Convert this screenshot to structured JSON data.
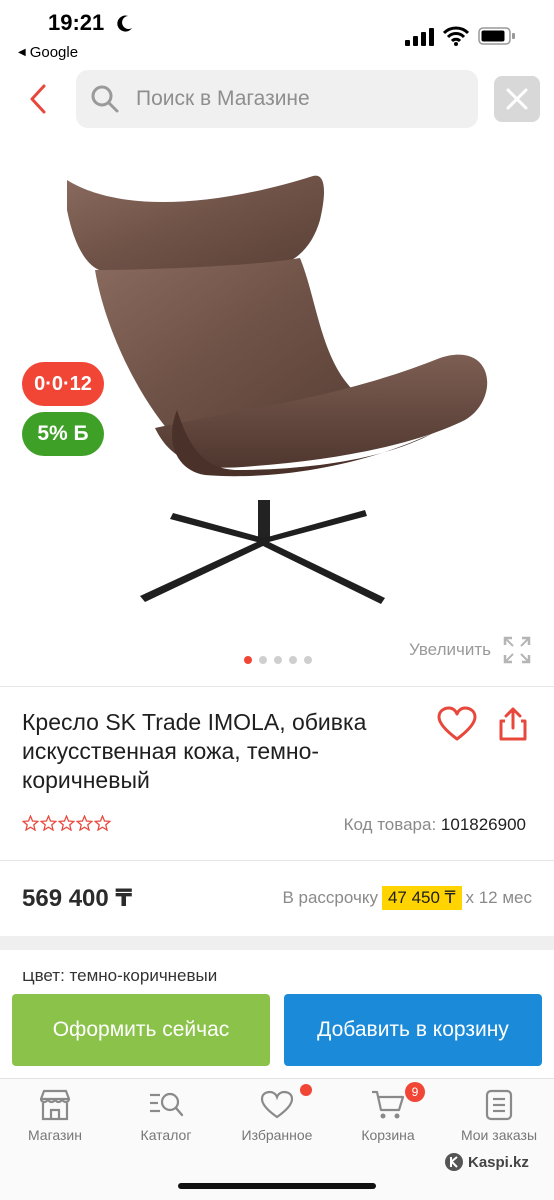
{
  "status_bar": {
    "time": "19:21",
    "back_app": "Google"
  },
  "search": {
    "placeholder": "Поиск в Магазине"
  },
  "gallery": {
    "badge_installment": "0·0·12",
    "badge_bonus": "5% Б",
    "zoom_label": "Увеличить",
    "dots_total": 5,
    "active_dot": 1
  },
  "product": {
    "title": "Кресло SK Trade IMOLA, обивка искусственная кожа, темно-коричневый",
    "rating_stars": 0,
    "code_label": "Код товара:",
    "code_value": "101826900",
    "price": "569 400 ₸",
    "installment_prefix": "В рассрочку",
    "installment_amount": "47 450 ₸",
    "installment_suffix": "x 12 мес",
    "color_peek": "Цвет: темно-коричневый"
  },
  "actions": {
    "buy_now": "Оформить сейчас",
    "add_to_cart": "Добавить в корзину"
  },
  "tabbar": {
    "items": [
      {
        "label": "Магазин",
        "icon": "shop-icon"
      },
      {
        "label": "Каталог",
        "icon": "catalog-search-icon"
      },
      {
        "label": "Избранное",
        "icon": "heart-icon"
      },
      {
        "label": "Корзина",
        "icon": "cart-icon"
      },
      {
        "label": "Мои заказы",
        "icon": "orders-icon"
      }
    ],
    "cart_count": "9"
  },
  "watermark": "Kaspi.kz",
  "colors": {
    "accent_red": "#f14635",
    "green": "#8bc34a",
    "blue": "#1b8bd9",
    "bonus_green": "#3fa028",
    "highlight": "#ffd400"
  }
}
